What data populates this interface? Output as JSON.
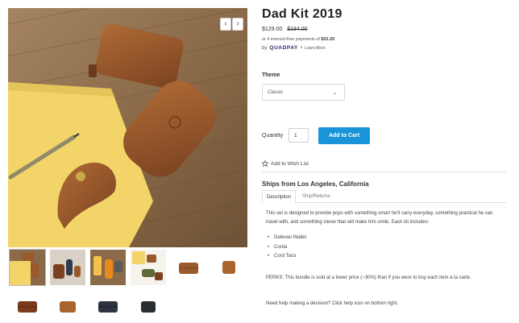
{
  "product": {
    "title": "Dad Kit 2019",
    "price_now": "$129.00",
    "price_old": "$184.00",
    "installment_prefix": "or 4 interest-free payments of",
    "installment_amount": "$32.25",
    "by_label": "by",
    "quadpay_logo": "QUADPAY",
    "learn_more": "Learn More"
  },
  "options": {
    "theme_label": "Theme",
    "theme_value": "Classic",
    "quantity_label": "Quantity",
    "quantity_value": "1",
    "add_to_cart": "Add to Cart",
    "wish_list": "Add to Wish List"
  },
  "details": {
    "ships_from": "Ships from Los Angeles, California",
    "tabs": [
      {
        "label": "Description",
        "active": true
      },
      {
        "label": "Ship/Returns",
        "active": false
      }
    ],
    "description": "This set is designed to provide pops with something smart he'll carry everyday, something practical he can travel with, and something clever that will make him smile. Each kit includes:",
    "items": [
      "Delevan Wallet",
      "Corda",
      "Cord Taco"
    ],
    "perks": "PERKS: This bundle is sold at a lower price (~30%) than if you were to buy each item a la carte.",
    "help": "Need help making a decision? Click help icon on bottom right."
  },
  "gallery": {
    "prev_icon": "chevron-left-icon",
    "next_icon": "chevron-right-icon",
    "thumbnail_count": 10
  },
  "colors": {
    "accent": "#1a94d9",
    "leather": "#9a5a2c",
    "notebook": "#f2d468",
    "wood": "#8a6a48"
  }
}
